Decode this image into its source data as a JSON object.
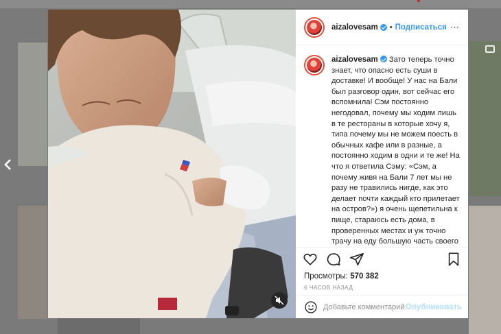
{
  "post": {
    "username": "aizalovesam",
    "separator": "•",
    "follow_label": "Подписаться",
    "more_icon": "⋯",
    "caption_text": "Зато теперь точно знает, что опасно есть суши в доставке! И вообще! У нас на Бали был разговор один, вот сейчас его вспомнила! Сэм постоянно негодовал, почему мы ходим лишь в те рестораны в которые хочу я, типа почему мы не можем поесть в обычных кафе или в разные, а постоянно ходим в одни и те же! На что я ответила Сэму: «Сэм, а почему живя на Бали 7 лет мы не разу не травились нигде, как это делает почти каждый кто прилетает на остров?») я очень щепетильна к пище, стараюсь есть дома, в проверенных местах и уж точно трачу на еду большую часть своего заработка! Потому что боюсь вот этого! 😭 доставка суш это русская",
    "views_label": "Просмотры:",
    "views_count": "570 382",
    "time_ago": "6 ЧАСОВ НАЗАД",
    "comment_placeholder": "Добавьте комментарий...",
    "post_button": "Опубликовать"
  },
  "icons": {
    "like": "heart-icon",
    "comment": "comment-icon",
    "share": "paper-plane-icon",
    "save": "bookmark-icon",
    "emoji": "smiley-icon",
    "mute": "speaker-muted-icon",
    "prev": "chevron-left-icon"
  },
  "colors": {
    "verified": "#3897f0",
    "follow": "#3897f0",
    "post_button_disabled": "#b2dffc",
    "overlay": "#6f6f6f"
  }
}
